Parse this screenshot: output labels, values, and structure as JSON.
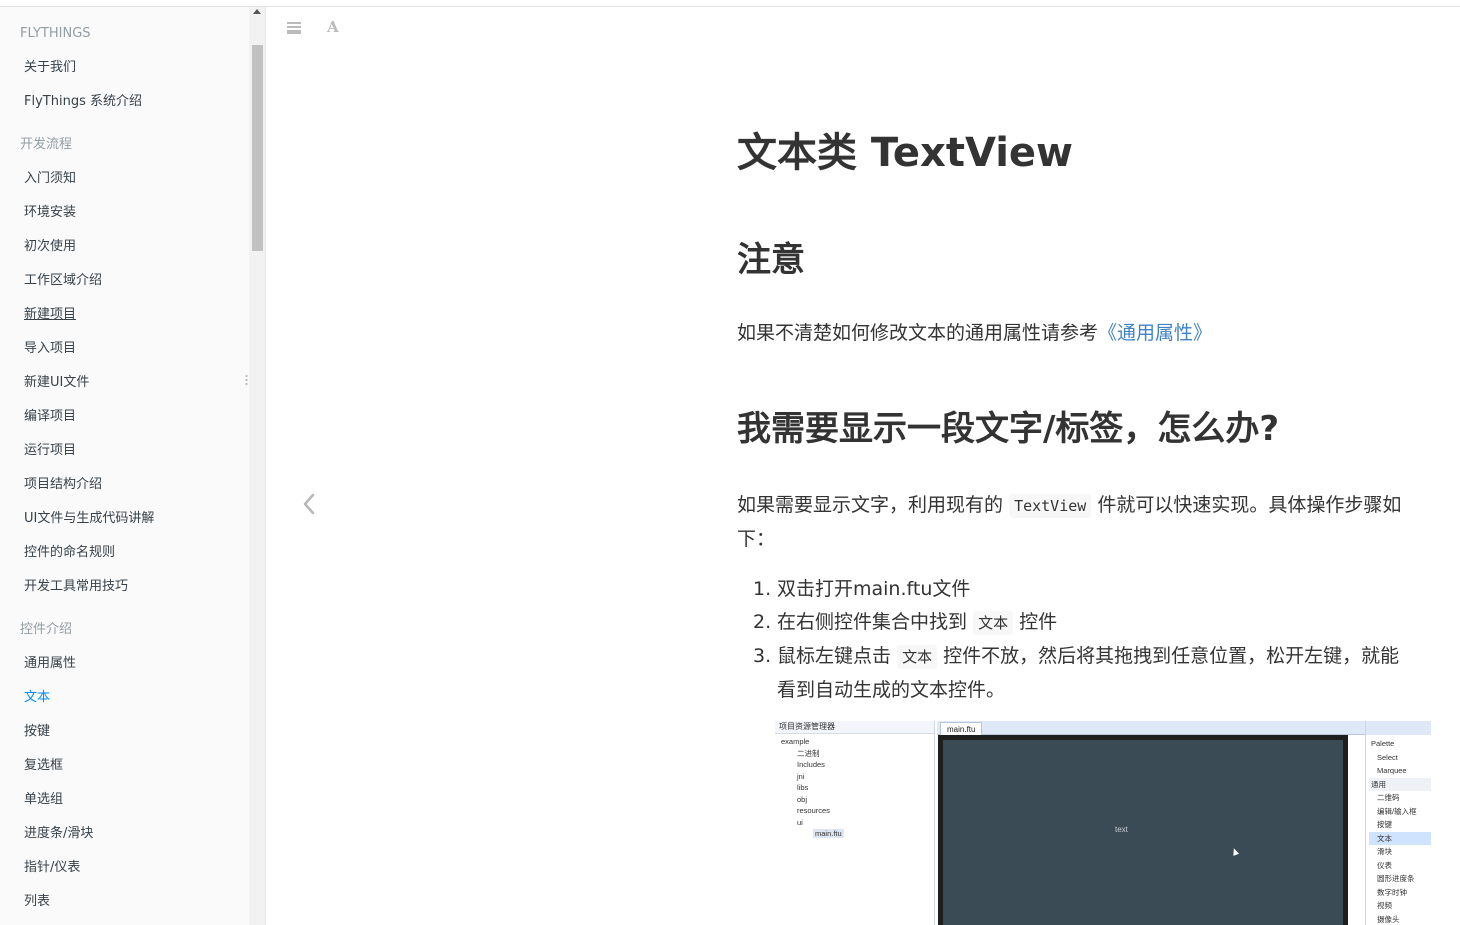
{
  "sidebar": {
    "groups": [
      {
        "title": "FLYTHINGS",
        "items": [
          {
            "label": "关于我们"
          },
          {
            "label": "FlyThings 系统介绍"
          }
        ]
      },
      {
        "title": "开发流程",
        "items": [
          {
            "label": "入门须知"
          },
          {
            "label": "环境安装"
          },
          {
            "label": "初次使用"
          },
          {
            "label": "工作区域介绍"
          },
          {
            "label": "新建项目"
          },
          {
            "label": "导入项目"
          },
          {
            "label": "新建UI文件"
          },
          {
            "label": "编译项目"
          },
          {
            "label": "运行项目"
          },
          {
            "label": "项目结构介绍"
          },
          {
            "label": "UI文件与生成代码讲解"
          },
          {
            "label": "控件的命名规则"
          },
          {
            "label": "开发工具常用技巧"
          }
        ]
      },
      {
        "title": "控件介绍",
        "items": [
          {
            "label": "通用属性"
          },
          {
            "label": "文本"
          },
          {
            "label": "按键"
          },
          {
            "label": "复选框"
          },
          {
            "label": "单选组"
          },
          {
            "label": "进度条/滑块"
          },
          {
            "label": "指针/仪表"
          },
          {
            "label": "列表"
          }
        ]
      }
    ],
    "active_item": "文本",
    "hovered_item": "新建项目"
  },
  "toolbar": {
    "menu_icon": "menu-icon",
    "font_icon_glyph": "A"
  },
  "content": {
    "title": "文本类 TextView",
    "h_notice": "注意",
    "notice_text": "如果不清楚如何修改文本的通用属性请参考",
    "notice_link": "《通用属性》",
    "h_question": "我需要显示一段文字/标签，怎么办?",
    "intro_before": "如果需要显示文字，利用现有的",
    "intro_code": "TextView",
    "intro_after": "件就可以快速实现。具体操作步骤如下：",
    "steps": [
      {
        "num": "1.",
        "text": "双击打开main.ftu文件"
      },
      {
        "num": "2.",
        "before": "在右侧控件集合中找到",
        "code": "文本",
        "after": "控件"
      },
      {
        "num": "3.",
        "before": "鼠标左键点击",
        "code": "文本",
        "after": "控件不放，然后将其拖拽到任意位置，松开左键，就能看到自动生成的文本控件。"
      }
    ]
  },
  "ide": {
    "explorer_title": "项目资源管理器",
    "tree": [
      "example",
      "二进制",
      "Includes",
      "jni",
      "libs",
      "obj",
      "resources",
      "ui",
      "main.ftu"
    ],
    "tab": "main.ftu",
    "canvas_text": "text",
    "palette": [
      "Palette",
      "Select",
      "Marquee",
      "通用",
      "二维码",
      "编辑/输入框",
      "按键",
      "文本",
      "滑块",
      "仪表",
      "圆形进度条",
      "数字时钟",
      "视频",
      "摄像头"
    ]
  },
  "colors": {
    "accent": "#008cff",
    "link": "#4183c4",
    "canvas": "#3b4b55"
  }
}
